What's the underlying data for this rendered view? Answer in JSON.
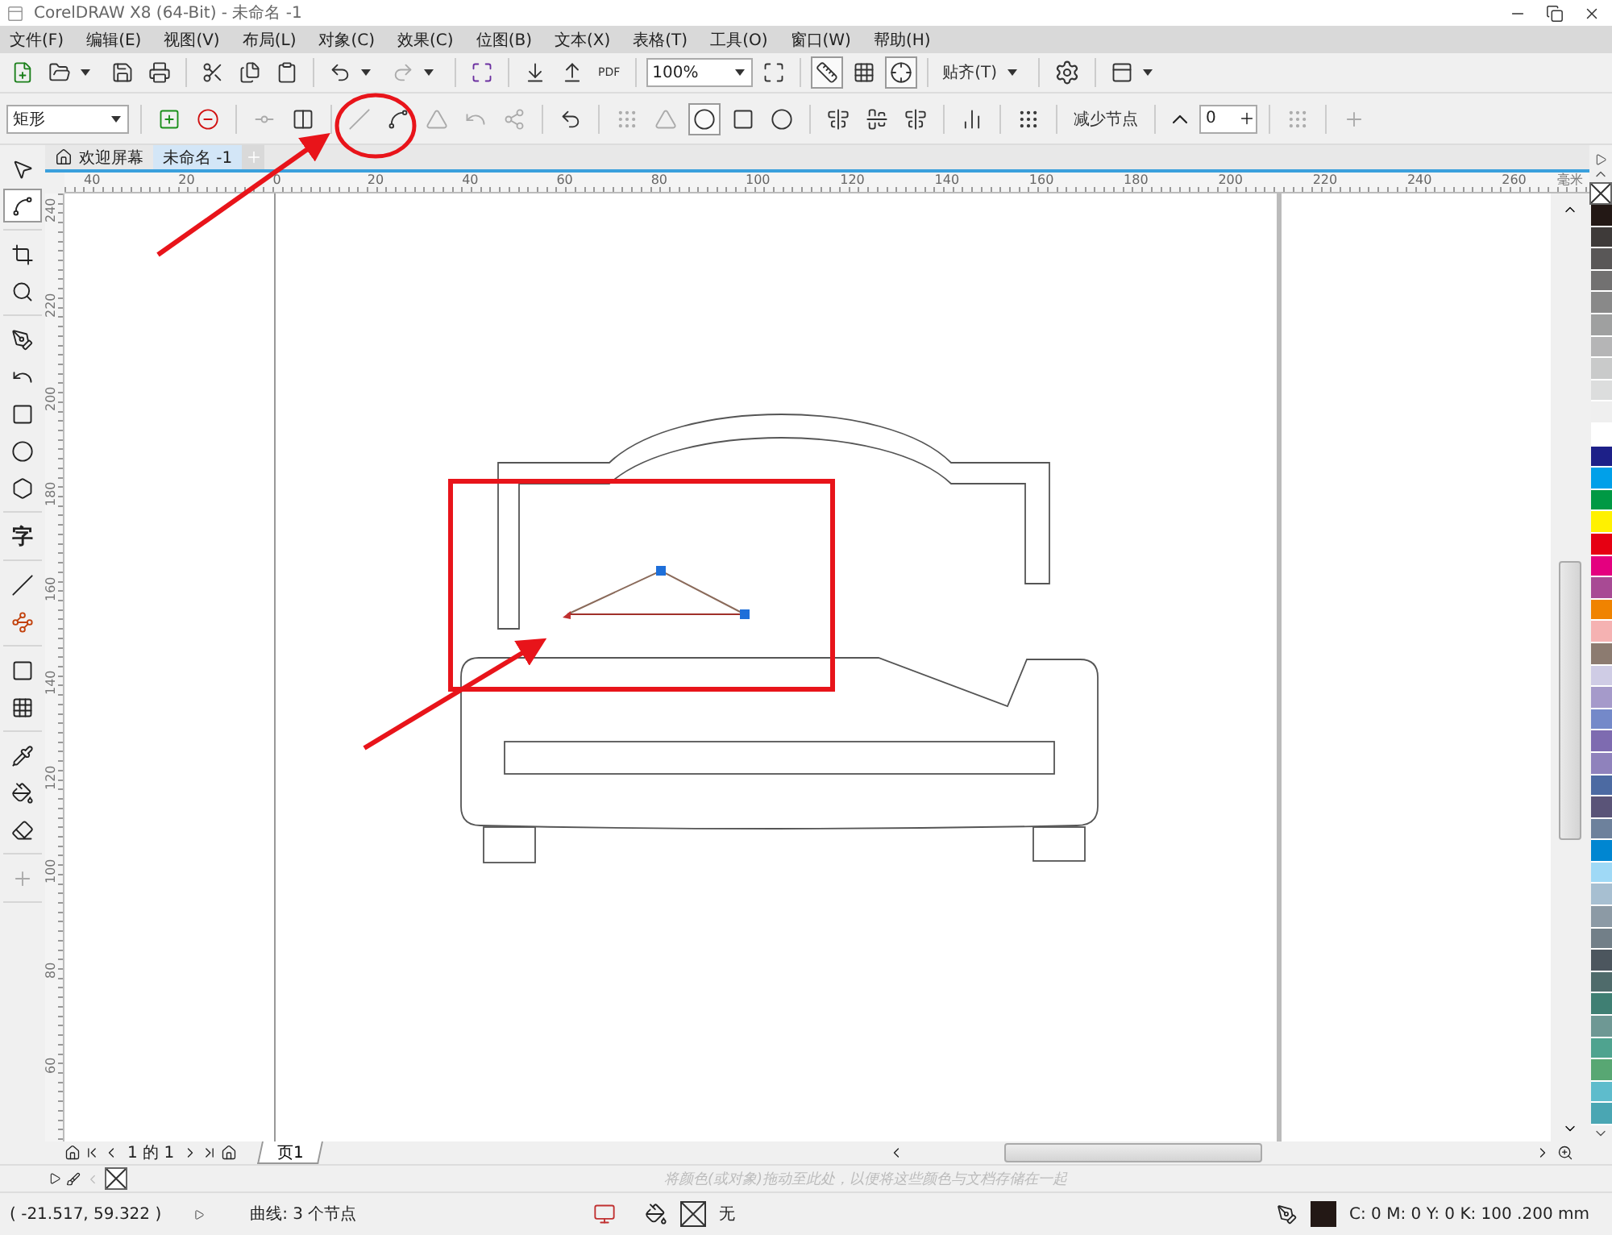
{
  "window": {
    "title": "CorelDRAW X8 (64-Bit) - 未命名 -1"
  },
  "menu": [
    "文件(F)",
    "编辑(E)",
    "视图(V)",
    "布局(L)",
    "对象(C)",
    "效果(C)",
    "位图(B)",
    "文本(X)",
    "表格(T)",
    "工具(O)",
    "窗口(W)",
    "帮助(H)"
  ],
  "standard_toolbar": {
    "pdf_label": "PDF",
    "zoom": "100%",
    "snap": "贴齐(T)",
    "view_toggles": [
      {
        "on": true
      },
      {
        "on": false
      },
      {
        "on": true
      }
    ]
  },
  "property_bar": {
    "object_type": "矩形",
    "reduce_nodes": "减少节点",
    "smoothness": "0"
  },
  "doc_tabs": [
    {
      "label": "欢迎屏幕",
      "selected": false
    },
    {
      "label": "未命名 -1",
      "selected": true
    }
  ],
  "toolbox": [
    [
      {
        "kind": "pick",
        "selected": false
      },
      {
        "kind": "shape",
        "selected": true
      }
    ],
    [
      {
        "kind": "crop",
        "selected": false
      },
      {
        "kind": "zoom",
        "selected": false
      }
    ],
    [
      {
        "kind": "pen",
        "selected": false
      },
      {
        "kind": "curve",
        "selected": false
      },
      {
        "kind": "rectangle",
        "selected": false
      },
      {
        "kind": "ellipse",
        "selected": false
      },
      {
        "kind": "polygon",
        "selected": false
      }
    ],
    [
      {
        "kind": "text",
        "label": "字",
        "selected": false
      }
    ],
    [
      {
        "kind": "line",
        "selected": false
      },
      {
        "kind": "connector",
        "selected": false
      }
    ],
    [
      {
        "kind": "frame",
        "selected": false
      },
      {
        "kind": "checker",
        "selected": false
      }
    ],
    [
      {
        "kind": "eyedropper",
        "selected": false
      },
      {
        "kind": "fill",
        "selected": false
      },
      {
        "kind": "smartfill",
        "selected": false
      }
    ],
    [
      {
        "kind": "add",
        "selected": false
      }
    ]
  ],
  "ruler": {
    "horizontal": [
      "40",
      "20",
      "0",
      "20",
      "40",
      "60",
      "80",
      "100",
      "120",
      "140",
      "160",
      "180",
      "200",
      "220",
      "240",
      "260"
    ],
    "unit": "毫米",
    "vertical": [
      "240",
      "220",
      "200",
      "180",
      "160",
      "140",
      "120",
      "100",
      "80",
      "60"
    ]
  },
  "page_nav": {
    "position": "1 的 1",
    "page_tab": "页1"
  },
  "palette_hint": "将颜色(或对象)拖动至此处，以便将这些颜色与文档存储在一起",
  "palette": [
    {
      "color": "#231815"
    },
    {
      "color": "#3e3a39"
    },
    {
      "color": "#595757"
    },
    {
      "color": "#727171"
    },
    {
      "color": "#898989"
    },
    {
      "color": "#9fa0a0"
    },
    {
      "color": "#b5b5b6"
    },
    {
      "color": "#c9caca"
    },
    {
      "color": "#dcdddd"
    },
    {
      "color": "#efefef"
    },
    {
      "color": "#ffffff"
    },
    {
      "color": "#1d2088"
    },
    {
      "color": "#00a0e9"
    },
    {
      "color": "#009944"
    },
    {
      "color": "#fff100"
    },
    {
      "color": "#e60012"
    },
    {
      "color": "#e4007f"
    },
    {
      "color": "#a84a94"
    },
    {
      "color": "#f08300"
    },
    {
      "color": "#f5b2b2"
    },
    {
      "color": "#8c7b70"
    },
    {
      "color": "#cfcce5"
    },
    {
      "color": "#a59aca"
    },
    {
      "color": "#7489c9"
    },
    {
      "color": "#7e6bb0"
    },
    {
      "color": "#8f82bc"
    },
    {
      "color": "#4c6aa2"
    },
    {
      "color": "#5a5478"
    },
    {
      "color": "#6d819c"
    },
    {
      "color": "#0086d1"
    },
    {
      "color": "#9fd9f6"
    },
    {
      "color": "#a7bfd1"
    },
    {
      "color": "#8c9aa5"
    },
    {
      "color": "#727f88"
    },
    {
      "color": "#4c565e"
    },
    {
      "color": "#4f6b6b"
    },
    {
      "color": "#3f7f73"
    },
    {
      "color": "#6e9894"
    },
    {
      "color": "#4fa38f"
    },
    {
      "color": "#58a773"
    },
    {
      "color": "#5ebccc"
    },
    {
      "color": "#4aa6b3"
    }
  ],
  "status_bar": {
    "coordinates": "( -21.517, 59.322 )",
    "selection": "曲线: 3 个节点",
    "fill": "无",
    "outline": "C: 0 M: 0 Y: 0 K: 100 .200 mm"
  }
}
